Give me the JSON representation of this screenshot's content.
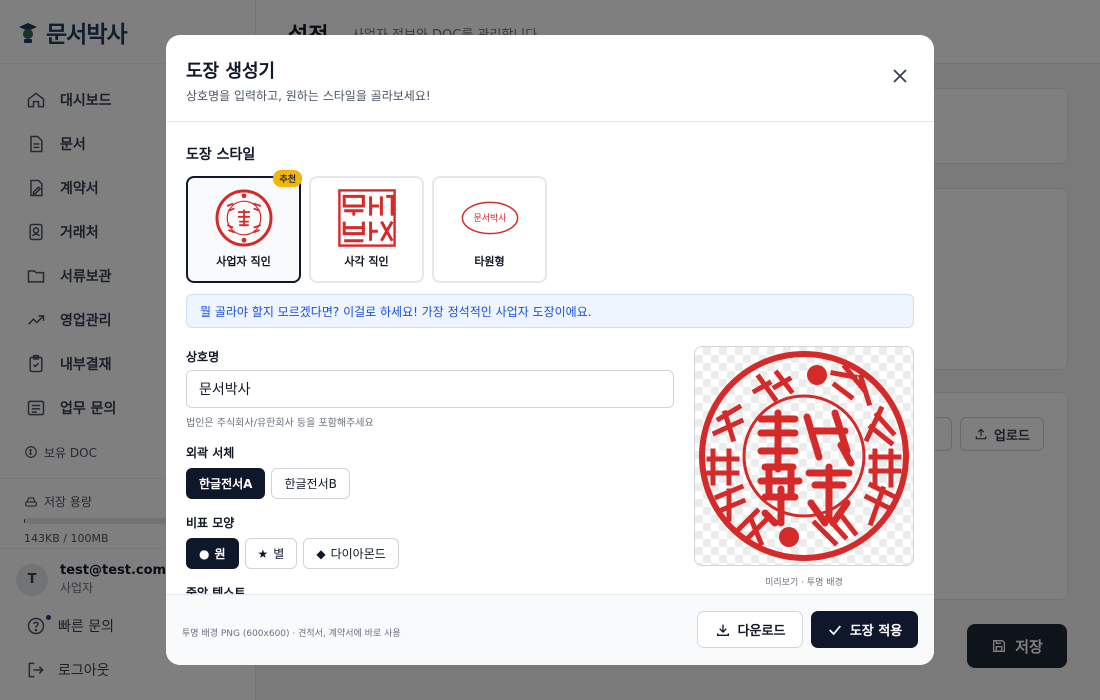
{
  "app": {
    "logo_text": "문서박사",
    "nav": [
      {
        "label": "대시보드",
        "icon": "home-icon"
      },
      {
        "label": "문서",
        "icon": "document-icon"
      },
      {
        "label": "계약서",
        "icon": "contract-icon"
      },
      {
        "label": "거래처",
        "icon": "contact-icon"
      },
      {
        "label": "서류보관",
        "icon": "folder-icon"
      },
      {
        "label": "영업관리",
        "icon": "trend-icon"
      },
      {
        "label": "내부결재",
        "icon": "clipboard-icon"
      },
      {
        "label": "업무 문의",
        "icon": "message-icon"
      }
    ],
    "doc_balance_label": "보유 DOC",
    "storage_label": "저장 용량",
    "storage_value": "143KB / 100MB",
    "storage_fraction": 0.0014,
    "user": {
      "initial": "T",
      "email": "test@test.com",
      "role": "사업자"
    },
    "quick_inquiry": "빠른 문의",
    "logout": "로그아웃",
    "page_title": "설정",
    "page_subtitle": "사업자 정보와 DOC를 관리합니다",
    "upload_label": "업로드",
    "save_label": "저장"
  },
  "modal": {
    "title": "도장 생성기",
    "subtitle": "상호명을 입력하고, 원하는 스타일을 골라보세요!",
    "style_section_label": "도장 스타일",
    "styles": [
      {
        "name": "사업자 직인",
        "badge": "추천",
        "selected": true
      },
      {
        "name": "사각 직인",
        "selected": false
      },
      {
        "name": "타원형",
        "selected": false
      }
    ],
    "oval_text": "문서박사",
    "hint": "뭘 골라야 할지 모르겠다면? 이걸로 하세요! 가장 정석적인 사업자 도장이에요.",
    "company_label": "상호명",
    "company_value": "문서박사",
    "company_help": "법인은 주식회사/유한회사 등을 포함해주세요",
    "outer_font_label": "외곽 서체",
    "outer_fonts": [
      "한글전서A",
      "한글전서B"
    ],
    "divider_label": "비표 모양",
    "dividers": [
      {
        "label": "원",
        "glyph": "●"
      },
      {
        "label": "별",
        "glyph": "★"
      },
      {
        "label": "다이아몬드",
        "glyph": "◆"
      }
    ],
    "center_text_label": "중앙 텍스트",
    "preview_caption": "미리보기 · 투명 배경",
    "footer_note": "투명 배경 PNG (600x600) · 견적서, 계약서에 바로 사용",
    "download_label": "다운로드",
    "apply_label": "도장 적용",
    "stamp_color": "#d42a2a"
  }
}
